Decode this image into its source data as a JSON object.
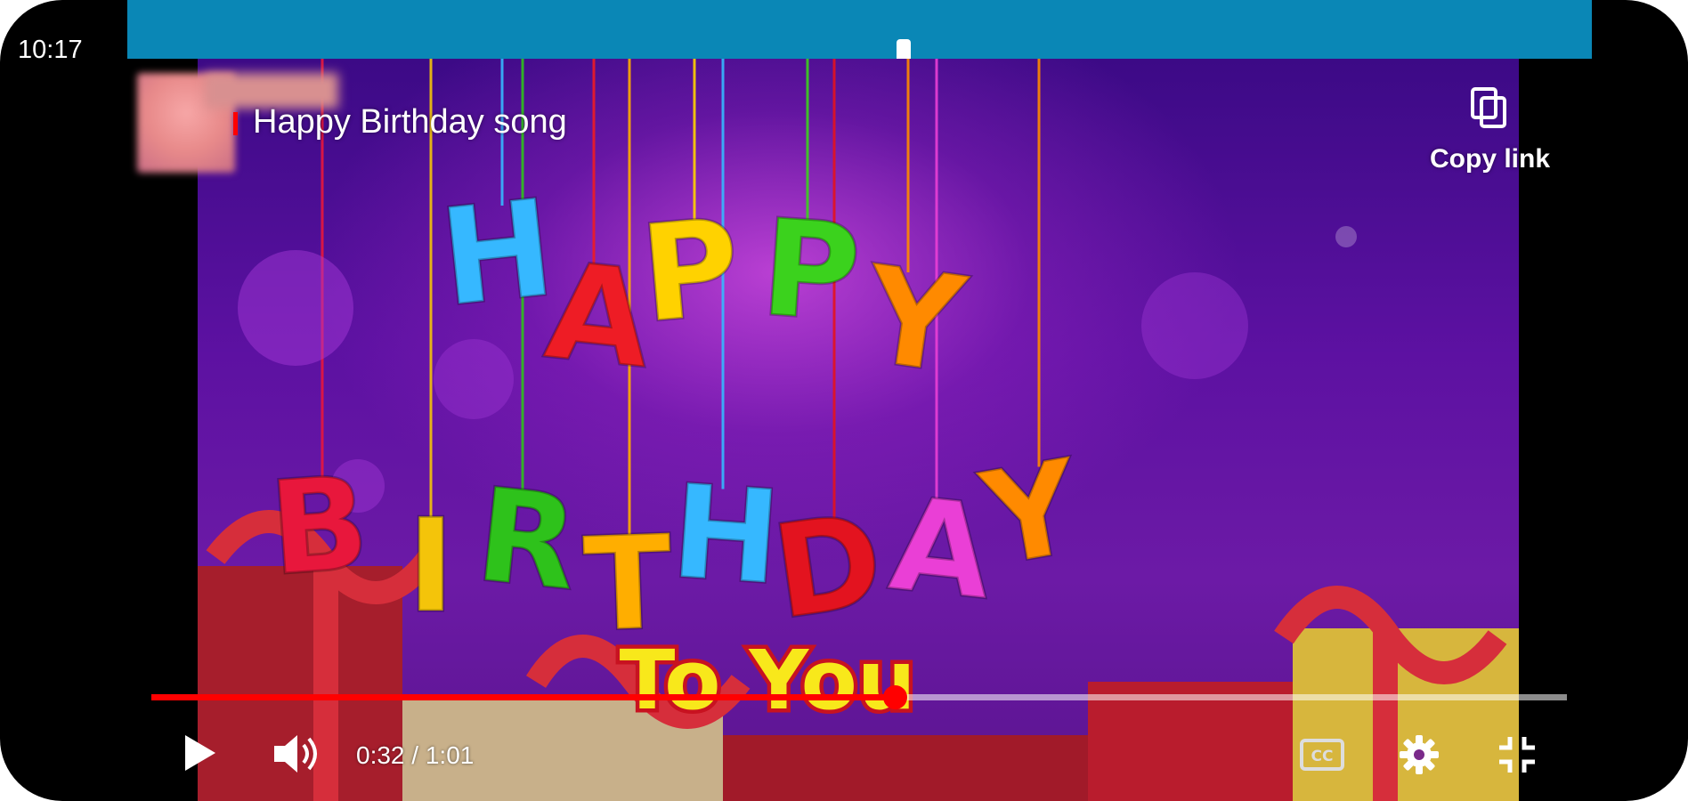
{
  "status_bar": {
    "time": "10:17"
  },
  "video": {
    "title": "Happy Birthday song",
    "copy_link_label": "Copy link",
    "current_time": "0:32",
    "duration": "1:01",
    "progress": 0.525,
    "artwork": {
      "words": [
        {
          "text": "HAPPY",
          "letters": [
            "H",
            "A",
            "P",
            "P",
            "Y"
          ],
          "colors": [
            "#36b8ff",
            "#ee1c25",
            "#ffd200",
            "#3bd21d",
            "#ff8a00"
          ]
        },
        {
          "text": "BIRTHDAY",
          "letters": [
            "B",
            "I",
            "R",
            "T",
            "H",
            "D",
            "A",
            "Y"
          ],
          "colors": [
            "#e8173c",
            "#f4c40a",
            "#2ec21b",
            "#ffae00",
            "#36b8ff",
            "#e3131f",
            "#ea3fd6",
            "#ff8a00"
          ]
        },
        {
          "text": "To You",
          "color": "#f8e81b",
          "outline": "#c81220"
        }
      ]
    }
  },
  "controls": {
    "play_icon": "play-icon",
    "volume_icon": "volume-icon",
    "cc_icon": "closed-captions-icon",
    "settings_icon": "gear-icon",
    "fullscreen_icon": "exit-fullscreen-icon"
  }
}
